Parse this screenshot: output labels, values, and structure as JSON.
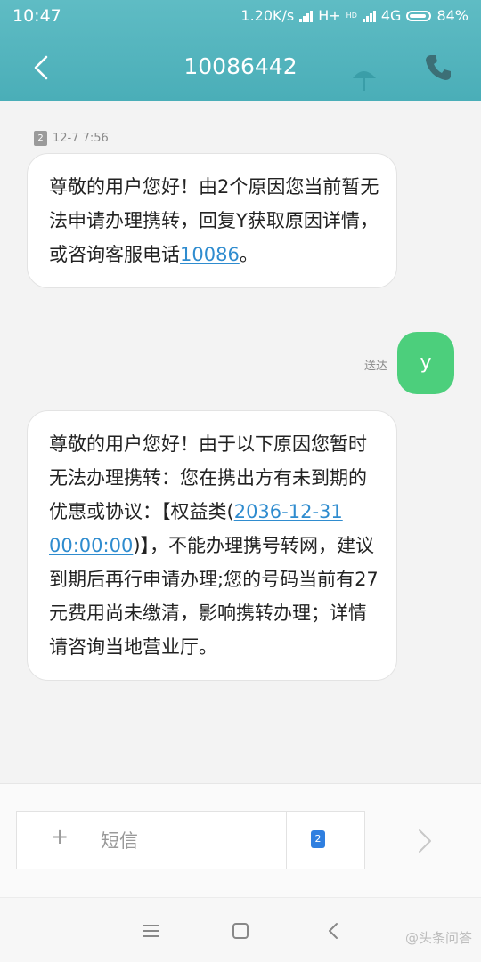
{
  "status_bar": {
    "time": "10:47",
    "speed": "1.20K/s",
    "network": "H+",
    "hd": "HD",
    "lte": "4G",
    "battery": "84%"
  },
  "title_bar": {
    "title": "10086442",
    "back_icon": "back-arrow-icon",
    "call_icon": "phone-icon"
  },
  "messages": {
    "sim_badge": "2",
    "timestamp": "12-7 7:56",
    "msg1_text": "尊敬的用户您好！由2个原因您当前暂无法申请办理携转，回复Y获取原因详情，或咨询客服电话",
    "msg1_link": "10086",
    "msg1_end": "。",
    "reply_text": "y",
    "reply_status": "送达",
    "msg2_a": "尊敬的用户您好！由于以下原因您暂时无法办理携转：您在携出方有未到期的优惠或协议：【权益类(",
    "msg2_link": "2036-12-31 00:00:00",
    "msg2_b": ")】，不能办理携号转网，建议到期后再行申请办理;您的号码当前有27元费用尚未缴清，影响携转办理；详情请咨询当地营业厅。"
  },
  "composer": {
    "plus": "+",
    "placeholder": "短信",
    "sim_label": "2",
    "send_icon": "chevron-right-icon"
  },
  "nav": {
    "menu_icon": "menu-icon",
    "home_icon": "square-icon",
    "back_icon": "back-icon",
    "watermark": "@头条问答"
  },
  "colors": {
    "header": "#4aaeb8",
    "bubble_out": "#4ccf7c",
    "link": "#2f8ccf"
  }
}
